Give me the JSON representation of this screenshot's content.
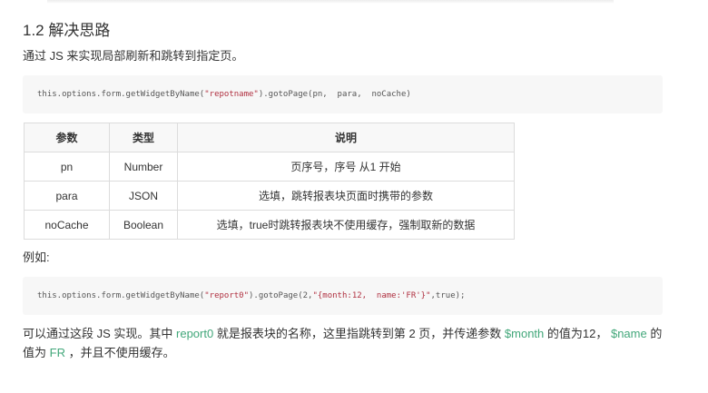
{
  "section": {
    "heading": "1.2 解决思路",
    "intro": "通过 JS 来实现局部刷新和跳转到指定页。"
  },
  "code1": {
    "prefix": "this.options.form.getWidgetByName(",
    "string": "\"repotname\"",
    "suffix": ").gotoPage(pn,  para,  noCache)"
  },
  "table": {
    "headers": [
      "参数",
      "类型",
      "说明"
    ],
    "rows": [
      [
        "pn",
        "Number",
        "页序号，序号 从1 开始"
      ],
      [
        "para",
        "JSON",
        "选填，跳转报表块页面时携带的参数"
      ],
      [
        "noCache",
        "Boolean",
        "选填，true时跳转报表块不使用缓存，强制取新的数据"
      ]
    ]
  },
  "example_label": "例如:",
  "code2": {
    "prefix": "this.options.form.getWidgetByName(",
    "string1": "\"report0\"",
    "middle": ").gotoPage(2,",
    "string2": "\"{month:12,  name:'FR'}\"",
    "suffix": ",true);"
  },
  "explanation": {
    "line1_a": "可以通过这段 JS 实现。其中 ",
    "line1_b": "report0",
    "line1_c": " 就是报表块的名称，这里指跳转到第 2 页，并传递参数 ",
    "line1_d": "$month",
    "line1_e": " 的值为12， ",
    "line1_f": "$name",
    "line1_g": " 的",
    "line2_a": "值为 ",
    "line2_b": "FR",
    "line2_c": " ，并且不使用缓存。"
  }
}
